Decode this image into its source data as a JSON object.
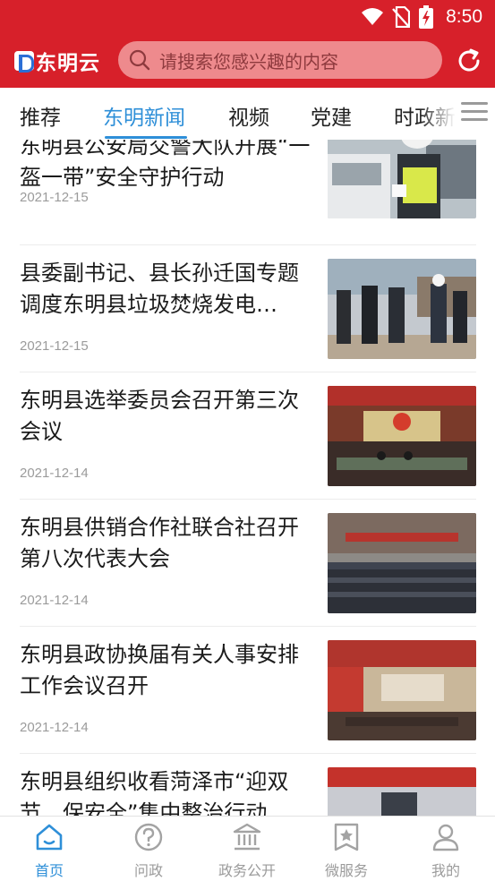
{
  "status_bar": {
    "time": "8:50"
  },
  "header": {
    "logo_text": "东明云",
    "search_placeholder": "请搜索您感兴趣的内容"
  },
  "tabs": [
    {
      "label": "推荐",
      "active": false
    },
    {
      "label": "东明新闻",
      "active": true
    },
    {
      "label": "视频",
      "active": false
    },
    {
      "label": "党建",
      "active": false
    },
    {
      "label": "时政新",
      "active": false
    }
  ],
  "news": [
    {
      "title": "东明县公安局交警大队开展“一盔一带”安全守护行动",
      "date": "2021-12-15",
      "image": "traffic-police-photo"
    },
    {
      "title": "县委副书记、县长孙迁国专题调度东明县垃圾焚烧发电…",
      "date": "2021-12-15",
      "image": "officials-inspection-photo"
    },
    {
      "title": "东明县选举委员会召开第三次会议",
      "date": "2021-12-14",
      "image": "election-meeting-photo"
    },
    {
      "title": "东明县供销合作社联合社召开第八次代表大会",
      "date": "2021-12-14",
      "image": "congress-group-photo"
    },
    {
      "title": "东明县政协换届有关人事安排工作会议召开",
      "date": "2021-12-14",
      "image": "cppcc-meeting-photo"
    },
    {
      "title": "东明县组织收看菏泽市“迎双节、保安全”集中整治行动",
      "date": "",
      "image": "video-conference-photo"
    }
  ],
  "bottom_nav": [
    {
      "label": "首页",
      "icon": "home-icon",
      "active": true
    },
    {
      "label": "问政",
      "icon": "question-icon",
      "active": false
    },
    {
      "label": "政务公开",
      "icon": "government-building-icon",
      "active": false
    },
    {
      "label": "微服务",
      "icon": "bookmark-star-icon",
      "active": false
    },
    {
      "label": "我的",
      "icon": "user-icon",
      "active": false
    }
  ],
  "colors": {
    "brand_red": "#d7202a",
    "accent_blue": "#2e8fd8"
  }
}
